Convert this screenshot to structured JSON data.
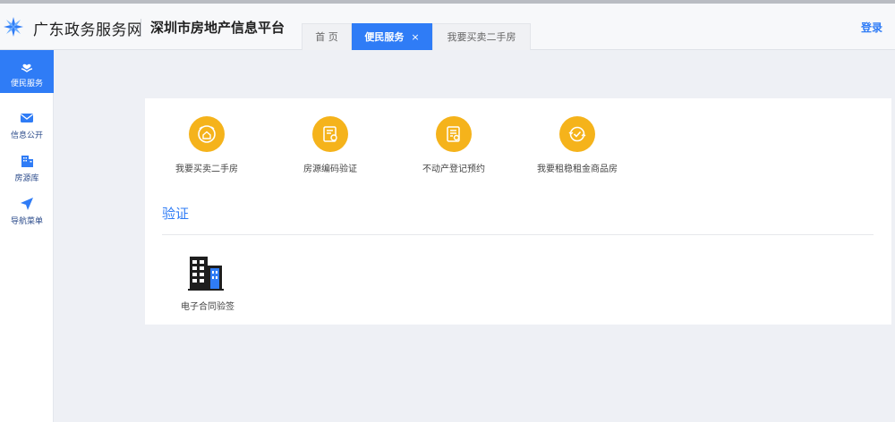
{
  "header": {
    "gov_title": "广东政务服务网",
    "platform_title": "深圳市房地产信息平台",
    "login_label": "登录",
    "tabs": [
      {
        "label": "首 页",
        "active": false
      },
      {
        "label": "便民服务",
        "active": true,
        "close": "×"
      },
      {
        "label": "我要买卖二手房",
        "active": false
      }
    ]
  },
  "sidebar": {
    "items": [
      {
        "label": "便民服务",
        "icon": "heart-hand-icon",
        "active": true
      },
      {
        "label": "信息公开",
        "icon": "mail-icon",
        "active": false
      },
      {
        "label": "房源库",
        "icon": "building-icon",
        "active": false
      },
      {
        "label": "导航菜单",
        "icon": "navigation-arrow-icon",
        "active": false
      }
    ]
  },
  "services": [
    {
      "label": "我要买卖二手房",
      "icon": "house-exchange-icon"
    },
    {
      "label": "房源编码验证",
      "icon": "certificate-icon"
    },
    {
      "label": "不动产登记预约",
      "icon": "register-document-icon"
    },
    {
      "label": "我要租稳租金商品房",
      "icon": "check-rotate-icon"
    }
  ],
  "section": {
    "title": "验证",
    "items": [
      {
        "label": "电子合同验签",
        "icon": "office-building-icon"
      }
    ]
  },
  "colors": {
    "accent": "#2f7cf6",
    "service_icon_bg": "#f5b31b",
    "page_bg": "#eef0f5"
  }
}
